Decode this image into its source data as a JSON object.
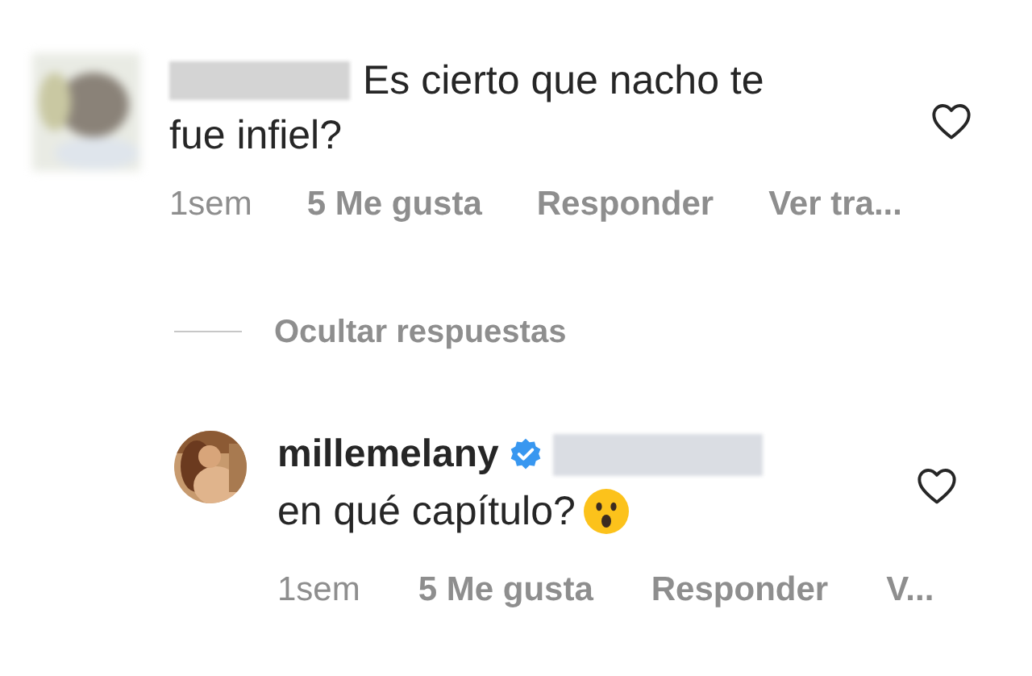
{
  "comment": {
    "text_lines": [
      "Es cierto que nacho te",
      "fue infiel?"
    ],
    "liked": false,
    "actions": {
      "time": "1sem",
      "likes": "5 Me gusta",
      "reply": "Responder",
      "translate": "Ver tra..."
    }
  },
  "replies_toggle": "Ocultar respuestas",
  "reply": {
    "username": "millemelany",
    "verified": true,
    "text": "en qué capítulo?",
    "liked": false,
    "actions": {
      "time": "1sem",
      "likes": "5 Me gusta",
      "reply": "Responder",
      "translate": "V..."
    }
  }
}
